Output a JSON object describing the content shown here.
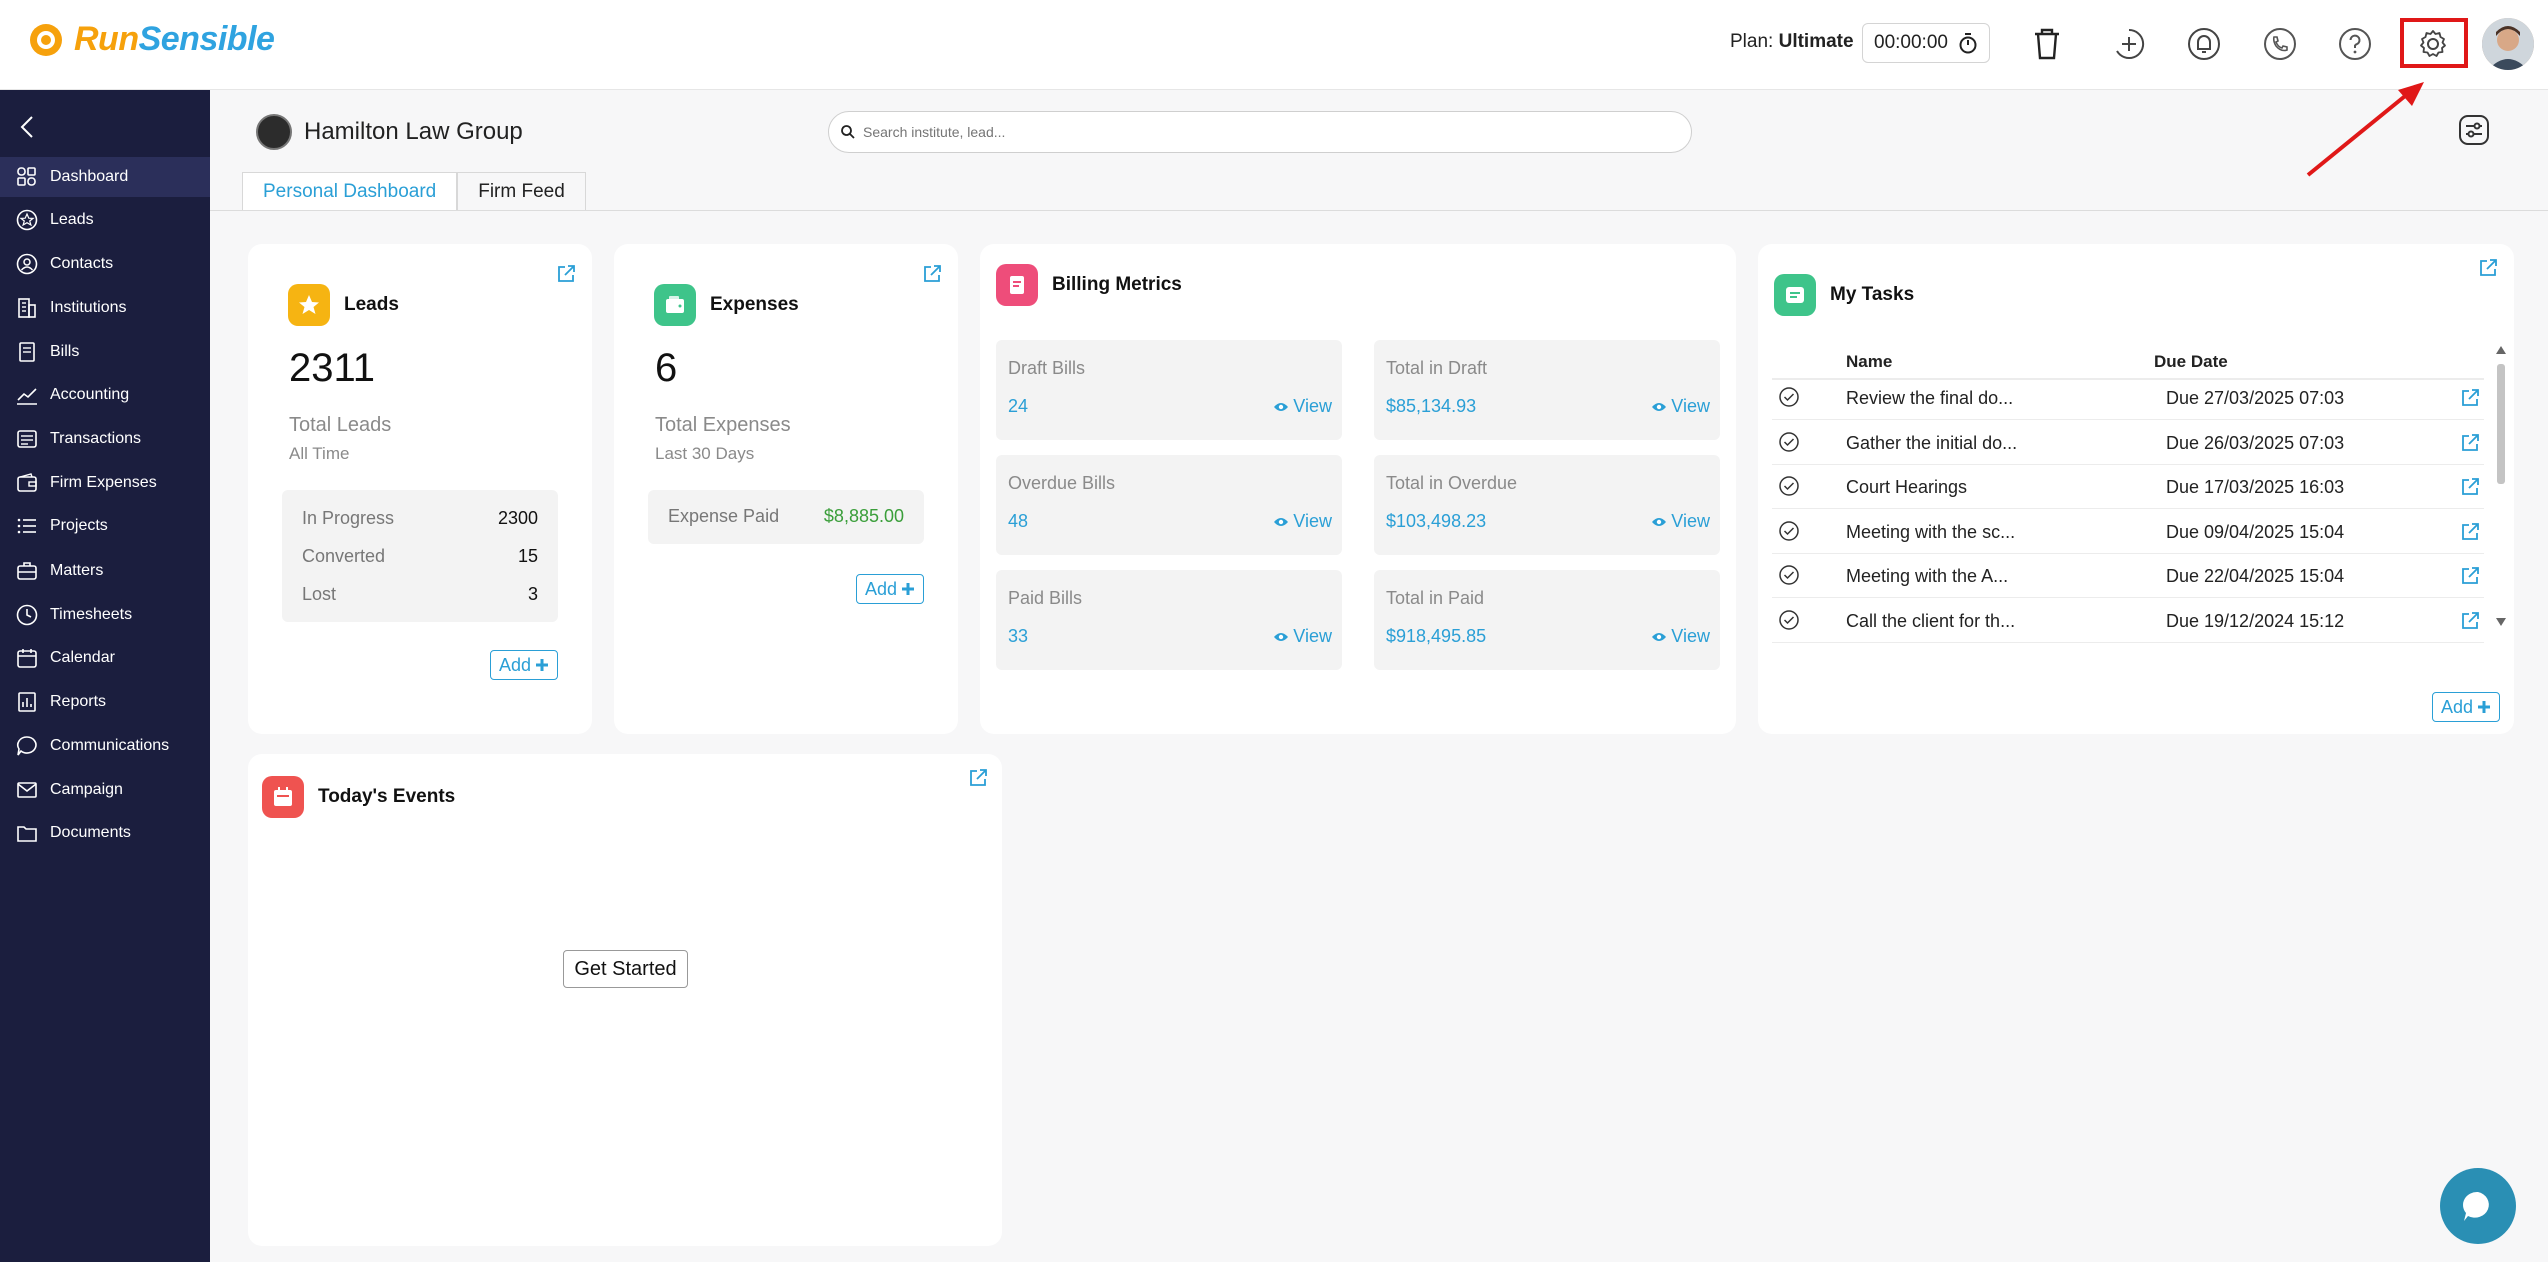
{
  "brand": {
    "part1": "Run",
    "part2": "Sensible"
  },
  "header": {
    "plan_label": "Plan:",
    "plan_value": "Ultimate",
    "timer": "00:00:00"
  },
  "sidebar": {
    "items": [
      {
        "label": "Dashboard",
        "icon": "dashboard-icon"
      },
      {
        "label": "Leads",
        "icon": "star-icon"
      },
      {
        "label": "Contacts",
        "icon": "contacts-icon"
      },
      {
        "label": "Institutions",
        "icon": "building-icon"
      },
      {
        "label": "Bills",
        "icon": "bill-icon"
      },
      {
        "label": "Accounting",
        "icon": "chart-icon"
      },
      {
        "label": "Transactions",
        "icon": "transactions-icon"
      },
      {
        "label": "Firm Expenses",
        "icon": "wallet-icon"
      },
      {
        "label": "Projects",
        "icon": "list-icon"
      },
      {
        "label": "Matters",
        "icon": "briefcase-icon"
      },
      {
        "label": "Timesheets",
        "icon": "clock-icon"
      },
      {
        "label": "Calendar",
        "icon": "calendar-icon"
      },
      {
        "label": "Reports",
        "icon": "report-icon"
      },
      {
        "label": "Communications",
        "icon": "chat-icon"
      },
      {
        "label": "Campaign",
        "icon": "mail-icon"
      },
      {
        "label": "Documents",
        "icon": "folder-icon"
      }
    ]
  },
  "firm": {
    "name": "Hamilton Law Group"
  },
  "search": {
    "placeholder": "Search institute, lead..."
  },
  "tabs": {
    "personal": "Personal Dashboard",
    "feed": "Firm Feed"
  },
  "leads": {
    "title": "Leads",
    "total": "2311",
    "subtitle": "Total Leads",
    "period": "All Time",
    "rows": [
      {
        "label": "In Progress",
        "value": "2300"
      },
      {
        "label": "Converted",
        "value": "15"
      },
      {
        "label": "Lost",
        "value": "3"
      }
    ],
    "add_label": "Add"
  },
  "expenses": {
    "title": "Expenses",
    "total": "6",
    "subtitle": "Total Expenses",
    "period": "Last 30 Days",
    "paid_label": "Expense Paid",
    "paid_value": "$8,885.00",
    "add_label": "Add"
  },
  "billing": {
    "title": "Billing Metrics",
    "view_label": "View",
    "metrics": [
      {
        "label": "Draft Bills",
        "value": "24"
      },
      {
        "label": "Total in Draft",
        "value": "$85,134.93"
      },
      {
        "label": "Overdue Bills",
        "value": "48"
      },
      {
        "label": "Total in Overdue",
        "value": "$103,498.23"
      },
      {
        "label": "Paid Bills",
        "value": "33"
      },
      {
        "label": "Total in Paid",
        "value": "$918,495.85"
      }
    ]
  },
  "tasks": {
    "title": "My Tasks",
    "col_name": "Name",
    "col_due": "Due Date",
    "rows": [
      {
        "name": "Review the final do...",
        "due": "Due 27/03/2025 07:03"
      },
      {
        "name": "Gather the initial do...",
        "due": "Due 26/03/2025 07:03"
      },
      {
        "name": "Court Hearings",
        "due": "Due 17/03/2025 16:03"
      },
      {
        "name": "Meeting with the sc...",
        "due": "Due 09/04/2025 15:04"
      },
      {
        "name": "Meeting with the A...",
        "due": "Due 22/04/2025 15:04"
      },
      {
        "name": "Call the client for th...",
        "due": "Due 19/12/2024 15:12"
      }
    ],
    "add_label": "Add"
  },
  "events": {
    "title": "Today's Events",
    "cta": "Get Started"
  },
  "colors": {
    "accent": "#2a9fd6",
    "sidebar_bg": "#1b1e3e",
    "brand_orange": "#f6a10c",
    "highlight_red": "#e01818",
    "paid_green": "#3a9e3a"
  }
}
